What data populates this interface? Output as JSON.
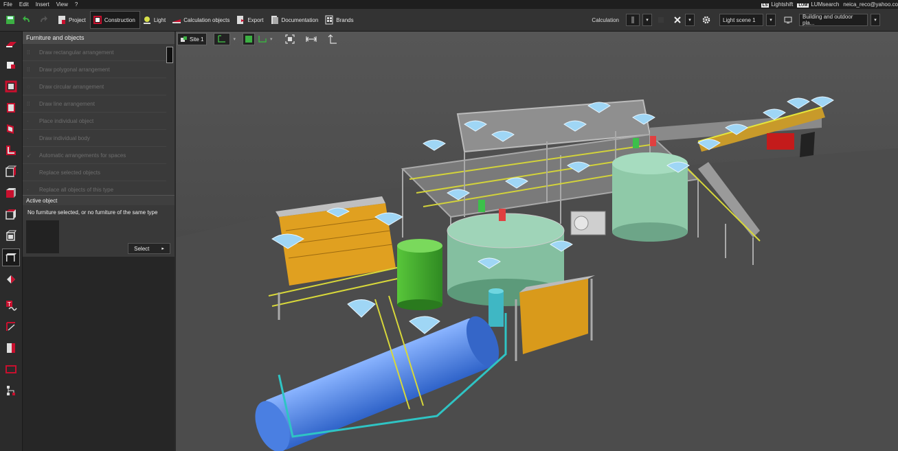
{
  "menu": {
    "items": [
      "File",
      "Edit",
      "Insert",
      "View",
      "?"
    ]
  },
  "account": {
    "lightshift": "Lightshift",
    "lumsearch": "LUMsearch",
    "email": "neica_reco@yahoo.co",
    "ls_badge": "LS",
    "lum_badge": "LUM"
  },
  "toolbar": {
    "tabs": [
      "Project",
      "Construction",
      "Light",
      "Calculation objects",
      "Export",
      "Documentation",
      "Brands"
    ],
    "active_tab": "Construction",
    "calculation_label": "Calculation",
    "light_scene": "Light scene 1",
    "building_mode": "Building and outdoor pla..."
  },
  "panel": {
    "title": "Furniture and objects",
    "items": [
      "Draw rectangular arrangement",
      "Draw polygonal arrangement",
      "Draw circular arrangement",
      "Draw line arrangement",
      "Place individual object",
      "Draw individual body",
      "Automatic arrangements for spaces",
      "Replace selected objects",
      "Replace all objects of this type"
    ],
    "active_object_title": "Active object",
    "active_object_text": "No furniture selected, or no furniture of the same type",
    "select_label": "Select"
  },
  "viewport": {
    "site_label": "Site 1"
  },
  "colors": {
    "accent": "#c8102e",
    "viewport_bg": "#505050",
    "panel_bg": "#262626"
  }
}
